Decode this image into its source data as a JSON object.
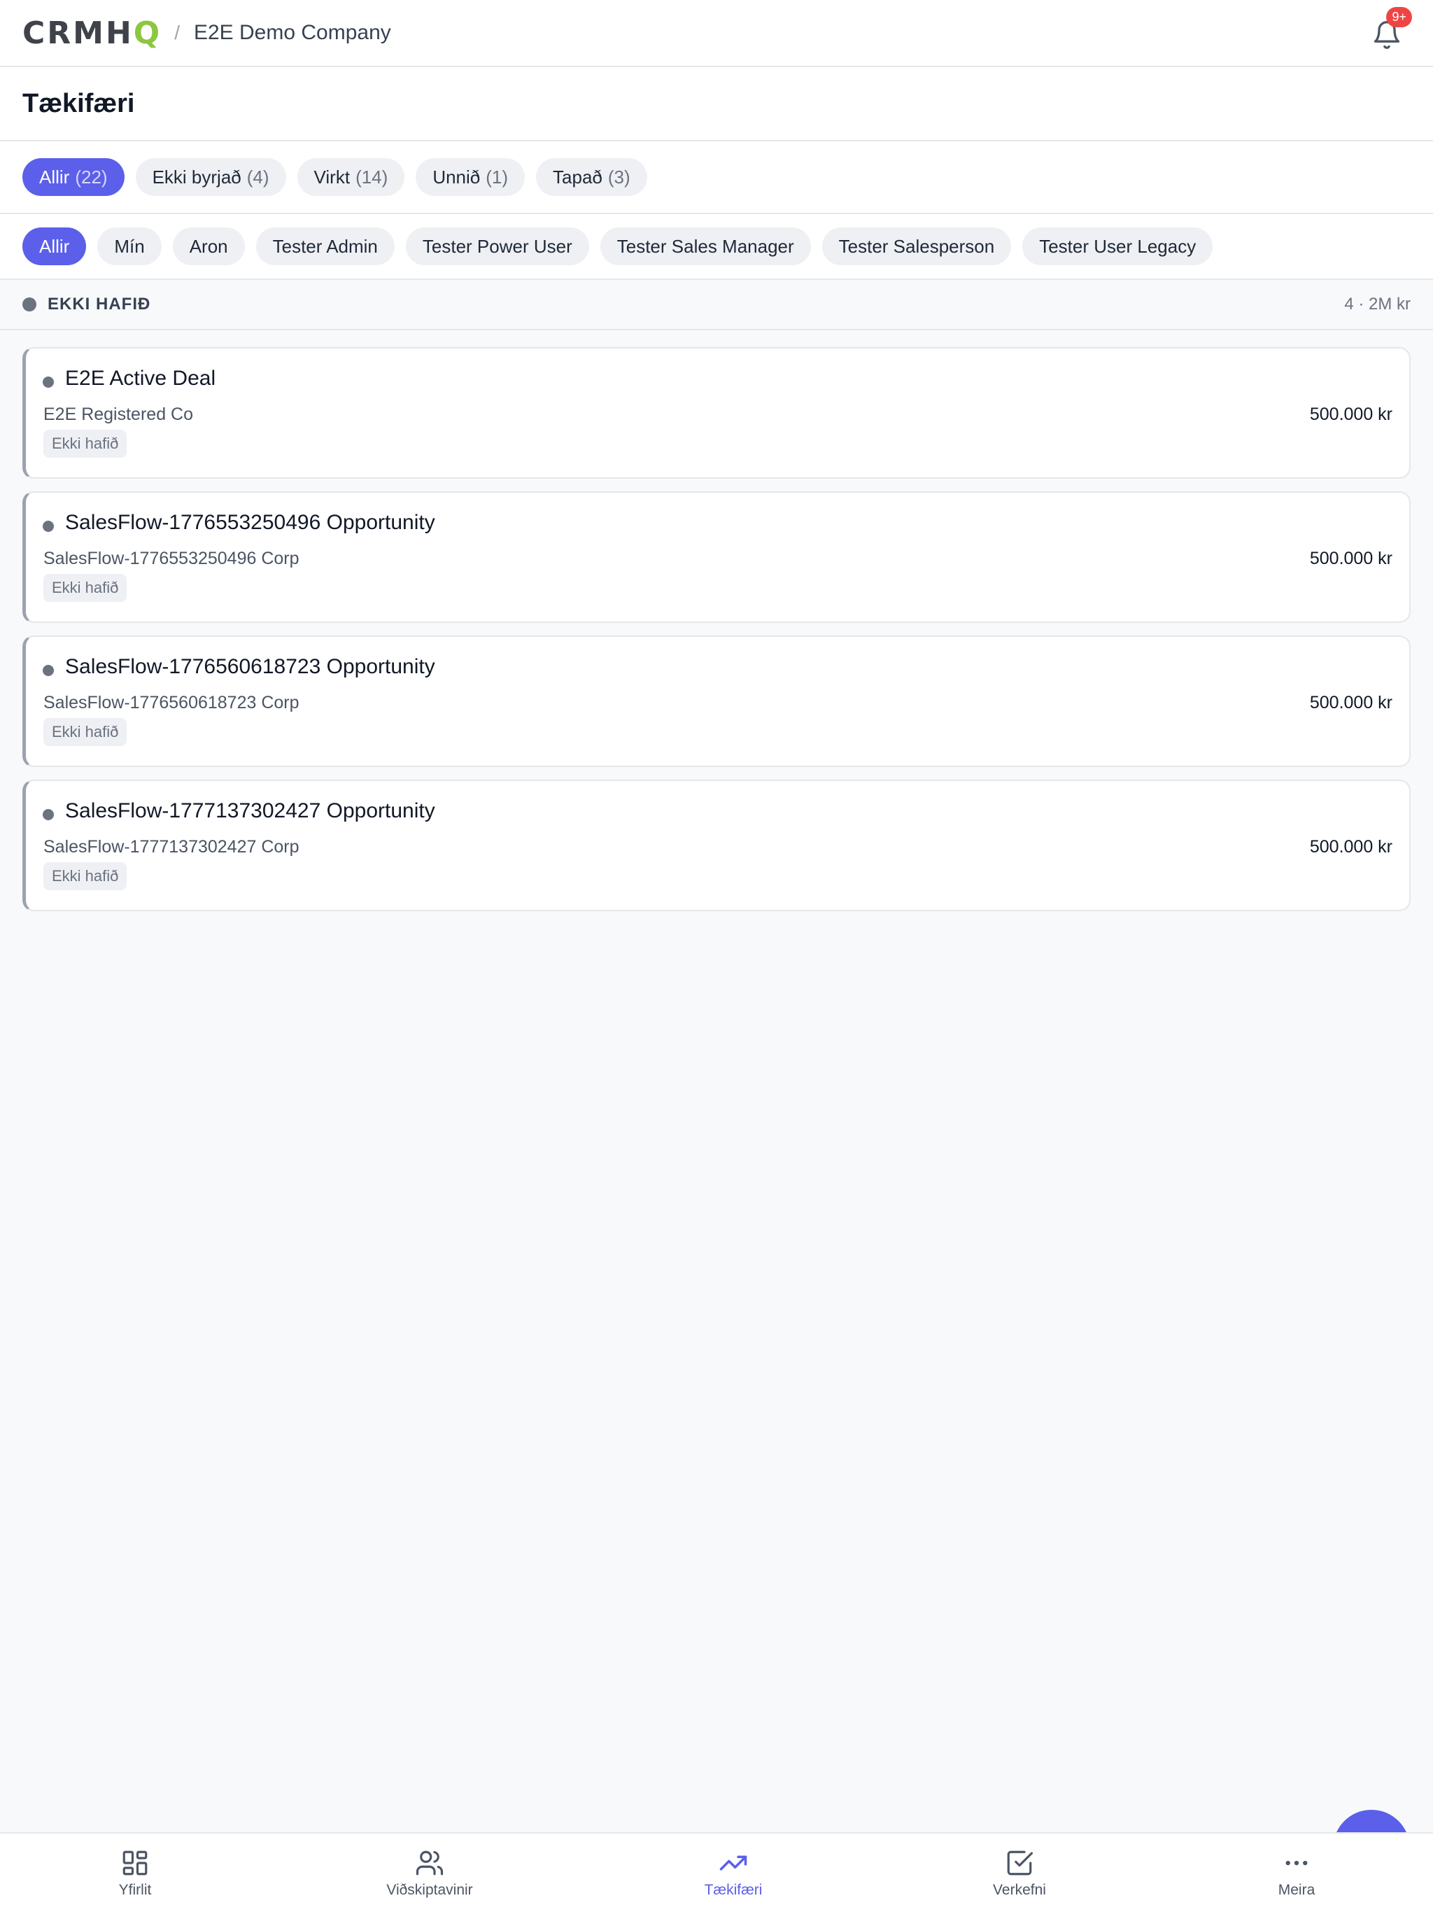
{
  "header": {
    "logo_main": "CRMH",
    "logo_accent": "Q",
    "separator": "/",
    "company": "E2E Demo Company",
    "notification_badge": "9+"
  },
  "page": {
    "title": "Tækifæri"
  },
  "status_filters": [
    {
      "label": "Allir",
      "count": "(22)"
    },
    {
      "label": "Ekki byrjað",
      "count": "(4)"
    },
    {
      "label": "Virkt",
      "count": "(14)"
    },
    {
      "label": "Unnið",
      "count": "(1)"
    },
    {
      "label": "Tapað",
      "count": "(3)"
    }
  ],
  "owner_filters": [
    {
      "label": "Allir"
    },
    {
      "label": "Mín"
    },
    {
      "label": "Aron"
    },
    {
      "label": "Tester Admin"
    },
    {
      "label": "Tester Power User"
    },
    {
      "label": "Tester Sales Manager"
    },
    {
      "label": "Tester Salesperson"
    },
    {
      "label": "Tester User Legacy"
    }
  ],
  "group": {
    "title": "EKKI HAFIÐ",
    "summary": "4 · 2M kr"
  },
  "deals": [
    {
      "title": "E2E Active Deal",
      "company": "E2E Registered Co",
      "tag": "Ekki hafið",
      "amount": "500.000 kr"
    },
    {
      "title": "SalesFlow-1776553250496 Opportunity",
      "company": "SalesFlow-1776553250496 Corp",
      "tag": "Ekki hafið",
      "amount": "500.000 kr"
    },
    {
      "title": "SalesFlow-1776560618723 Opportunity",
      "company": "SalesFlow-1776560618723 Corp",
      "tag": "Ekki hafið",
      "amount": "500.000 kr"
    },
    {
      "title": "SalesFlow-1777137302427 Opportunity",
      "company": "SalesFlow-1777137302427 Corp",
      "tag": "Ekki hafið",
      "amount": "500.000 kr"
    }
  ],
  "bottom_nav": [
    {
      "label": "Yfirlit",
      "icon": "grid-icon"
    },
    {
      "label": "Viðskiptavinir",
      "icon": "users-icon"
    },
    {
      "label": "Tækifæri",
      "icon": "trending-up-icon"
    },
    {
      "label": "Verkefni",
      "icon": "checkbox-icon"
    },
    {
      "label": "Meira",
      "icon": "more-icon"
    }
  ],
  "colors": {
    "accent": "#5b5fe9",
    "logo_accent": "#8dc63f",
    "badge": "#ef4444"
  }
}
